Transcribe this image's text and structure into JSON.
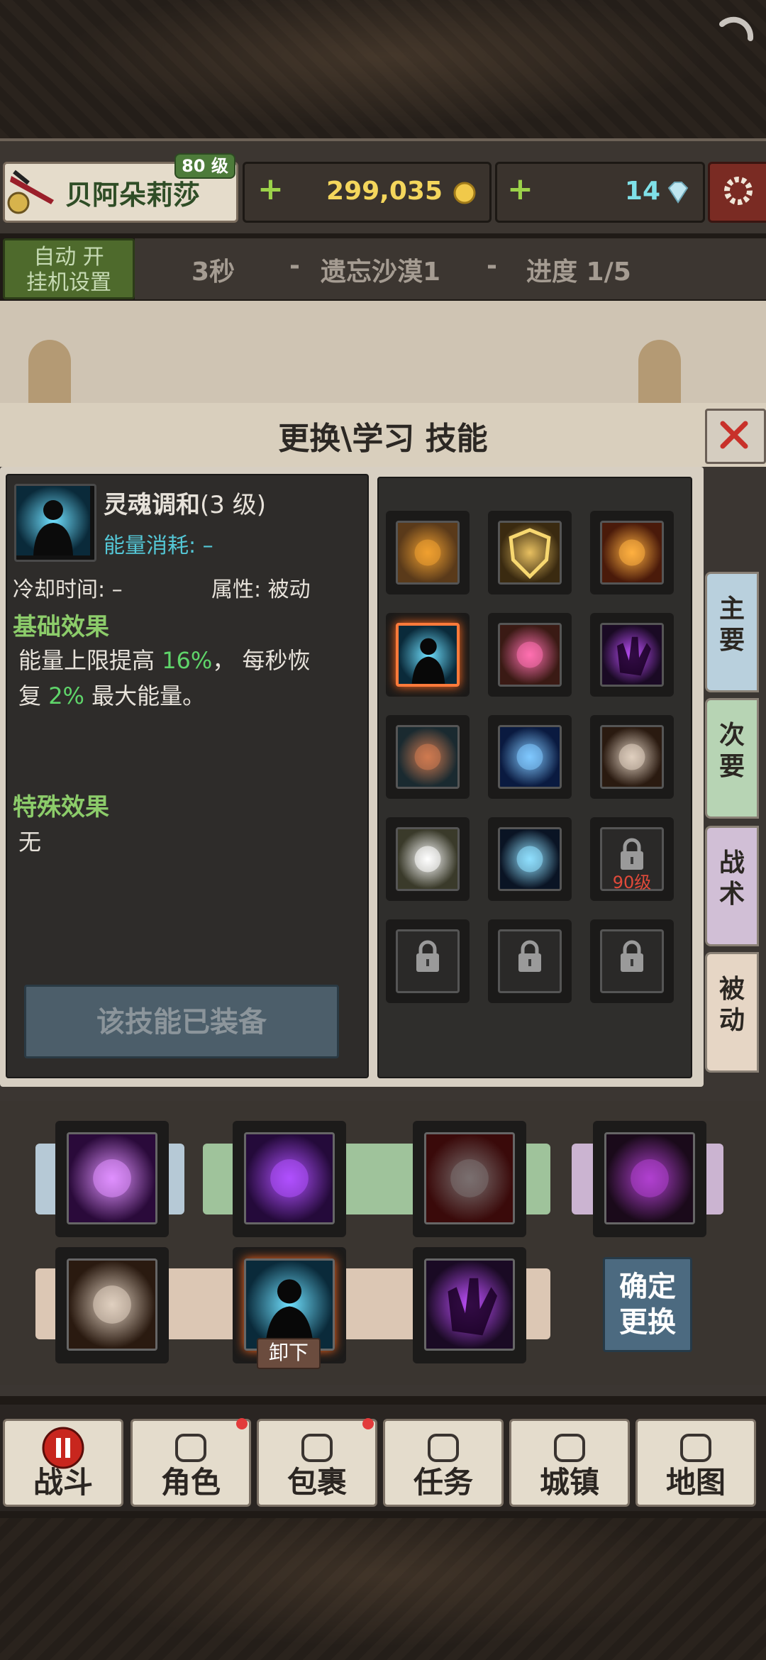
{
  "player": {
    "name": "贝阿朵莉莎",
    "level": "80 级"
  },
  "currency": {
    "gold": "299,035",
    "gems": "14"
  },
  "auto": {
    "line1": "自动 开",
    "line2": "挂机设置"
  },
  "stage": {
    "timer": "3秒",
    "sep1": "-",
    "name": "遗忘沙漠1",
    "sep2": "-",
    "progress": "进度 1/5"
  },
  "dialog": {
    "title": "更换\\学习 技能"
  },
  "skill": {
    "name": "灵魂调和",
    "level": "(3 级)",
    "energy_label": "能量消耗:",
    "energy_value": "–",
    "cooldown_label": "冷却时间:",
    "cooldown_value": "–",
    "attr_label": "属性:",
    "attr_value": "被动",
    "base_title": "基础效果",
    "base_p1": "能量上限提高 ",
    "base_v1": "16%",
    "base_p2": "， 每秒恢",
    "base_p3": "复 ",
    "base_v2": "2%",
    "base_p4": " 最大能量。",
    "special_title": "特殊效果",
    "special_text": "无",
    "equipped_button": "该技能已装备"
  },
  "grid": {
    "locked_label": "90级",
    "icons": [
      "bear-icon",
      "shield-icon",
      "explosion-icon",
      "soul-harmony-icon",
      "orb-icon",
      "shadow-hand-icon",
      "serpent-icon",
      "light-beam-icon",
      "masked-warrior-icon",
      "radiant-burst-icon",
      "crescent-spirit-icon",
      "locked",
      "locked",
      "locked",
      "locked"
    ]
  },
  "side_tabs": [
    {
      "line1": "主",
      "line2": "要",
      "color": "#b9d0dd"
    },
    {
      "line1": "次",
      "line2": "要",
      "color": "#b7d4b4"
    },
    {
      "line1": "战",
      "line2": "术",
      "color": "#d1bfd6"
    },
    {
      "line1": "被",
      "line2": "动",
      "color": "#e6d6c5"
    }
  ],
  "loadout": {
    "row1": [
      "violet-lightning-icon",
      "purple-vortex-icon",
      "armored-knight-icon",
      "shadow-face-icon"
    ],
    "row2": [
      "masked-warrior-icon",
      "soul-harmony-icon",
      "shadow-hand-icon"
    ],
    "unequip_label": "卸下",
    "confirm_line1": "确定",
    "confirm_line2": "更换"
  },
  "nav": [
    {
      "label": "战斗",
      "icon": "pause-icon"
    },
    {
      "label": "角色",
      "icon": "character-icon"
    },
    {
      "label": "包裹",
      "icon": "bag-icon"
    },
    {
      "label": "任务",
      "icon": "quest-icon"
    },
    {
      "label": "城镇",
      "icon": "town-icon"
    },
    {
      "label": "地图",
      "icon": "map-icon"
    }
  ]
}
